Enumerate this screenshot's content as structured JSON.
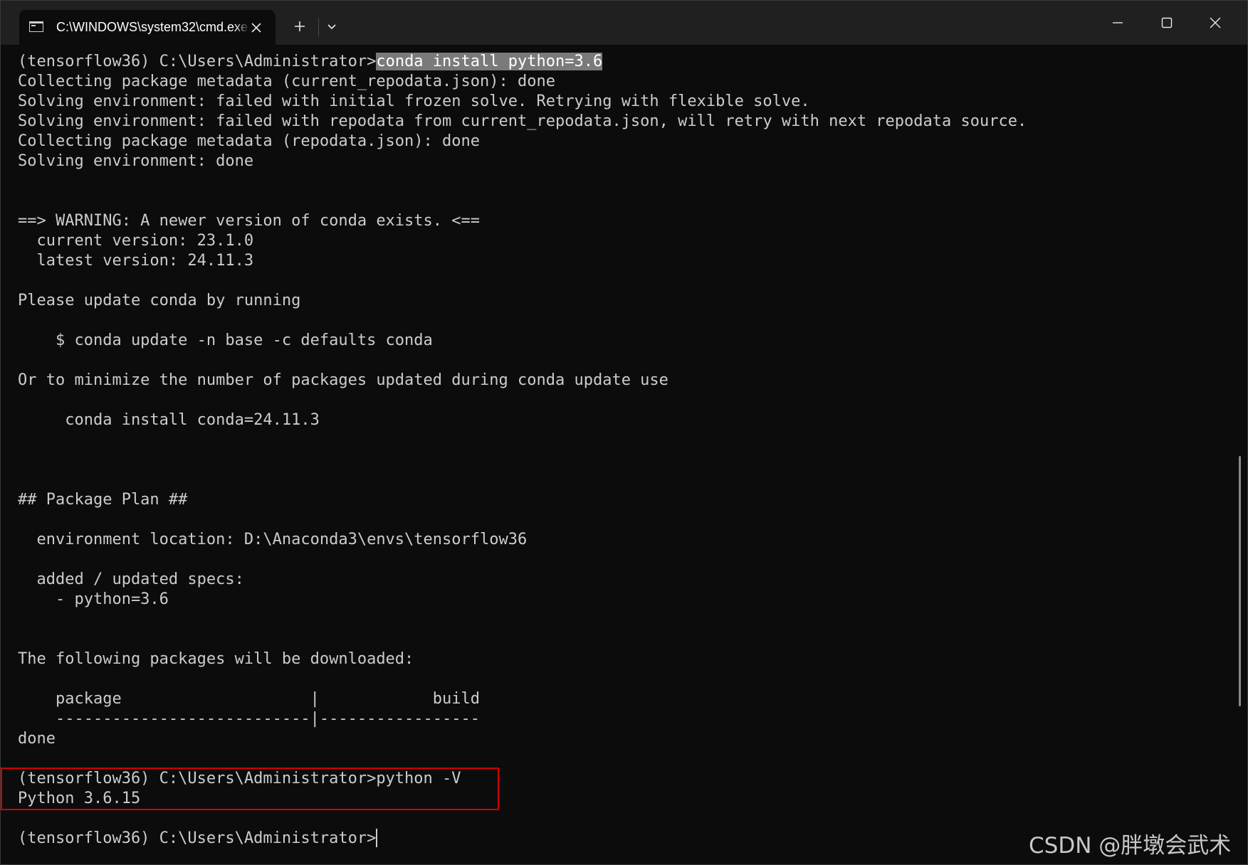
{
  "tab": {
    "title": "C:\\WINDOWS\\system32\\cmd.exe",
    "icon": "cmd-console-icon"
  },
  "window_controls": [
    "minimize-icon",
    "maximize-icon",
    "close-icon"
  ],
  "terminal": {
    "selected_command": "conda install python=3.6",
    "lines": [
      "(tensorflow36) C:\\Users\\Administrator>",
      "Collecting package metadata (current_repodata.json): done",
      "Solving environment: failed with initial frozen solve. Retrying with flexible solve.",
      "Solving environment: failed with repodata from current_repodata.json, will retry with next repodata source.",
      "Collecting package metadata (repodata.json): done",
      "Solving environment: done",
      "",
      "",
      "==> WARNING: A newer version of conda exists. <==",
      "  current version: 23.1.0",
      "  latest version: 24.11.3",
      "",
      "Please update conda by running",
      "",
      "    $ conda update -n base -c defaults conda",
      "",
      "Or to minimize the number of packages updated during conda update use",
      "",
      "     conda install conda=24.11.3",
      "",
      "",
      "",
      "## Package Plan ##",
      "",
      "  environment location: D:\\Anaconda3\\envs\\tensorflow36",
      "",
      "  added / updated specs:",
      "    - python=3.6",
      "",
      "",
      "The following packages will be downloaded:",
      "",
      "    package                    |            build",
      "    ---------------------------|-----------------",
      "done",
      "",
      "(tensorflow36) C:\\Users\\Administrator>python -V",
      "Python 3.6.15",
      "",
      "(tensorflow36) C:\\Users\\Administrator>"
    ]
  },
  "colors": {
    "background": "#0c0c0c",
    "titlebar": "#202020",
    "text": "#cccccc",
    "selection": "#7a7a7a",
    "highlight_box": "#d40000"
  },
  "watermark": "CSDN @胖墩会武术"
}
